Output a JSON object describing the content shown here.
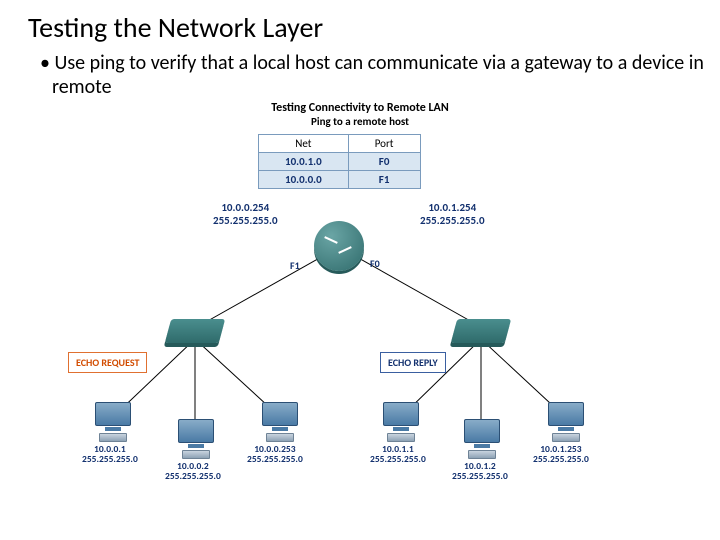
{
  "title": "Testing the Network Layer",
  "bullet": "• Use ping to verify that a local host can communicate via a gateway to a device in remote",
  "diagram": {
    "title": "Testing Connectivity to Remote LAN",
    "subtitle": "Ping to a remote host",
    "routing_table": {
      "col_net": "Net",
      "col_port": "Port",
      "rows": [
        {
          "net": "10.0.1.0",
          "port": "F0"
        },
        {
          "net": "10.0.0.0",
          "port": "F1"
        }
      ]
    },
    "router_iface": {
      "left": {
        "ip": "10.0.0.254",
        "mask": "255.255.255.0",
        "port": "F1"
      },
      "right": {
        "ip": "10.0.1.254",
        "mask": "255.255.255.0",
        "port": "F0"
      }
    },
    "badge_request": "ECHO REQUEST",
    "badge_reply": "ECHO REPLY",
    "hosts": {
      "h1": {
        "ip": "10.0.0.1",
        "mask": "255.255.255.0"
      },
      "h2": {
        "ip": "10.0.0.2",
        "mask": "255.255.255.0"
      },
      "h3": {
        "ip": "10.0.0.253",
        "mask": "255.255.255.0"
      },
      "h4": {
        "ip": "10.0.1.1",
        "mask": "255.255.255.0"
      },
      "h5": {
        "ip": "10.0.1.2",
        "mask": "255.255.255.0"
      },
      "h6": {
        "ip": "10.0.1.253",
        "mask": "255.255.255.0"
      }
    }
  }
}
